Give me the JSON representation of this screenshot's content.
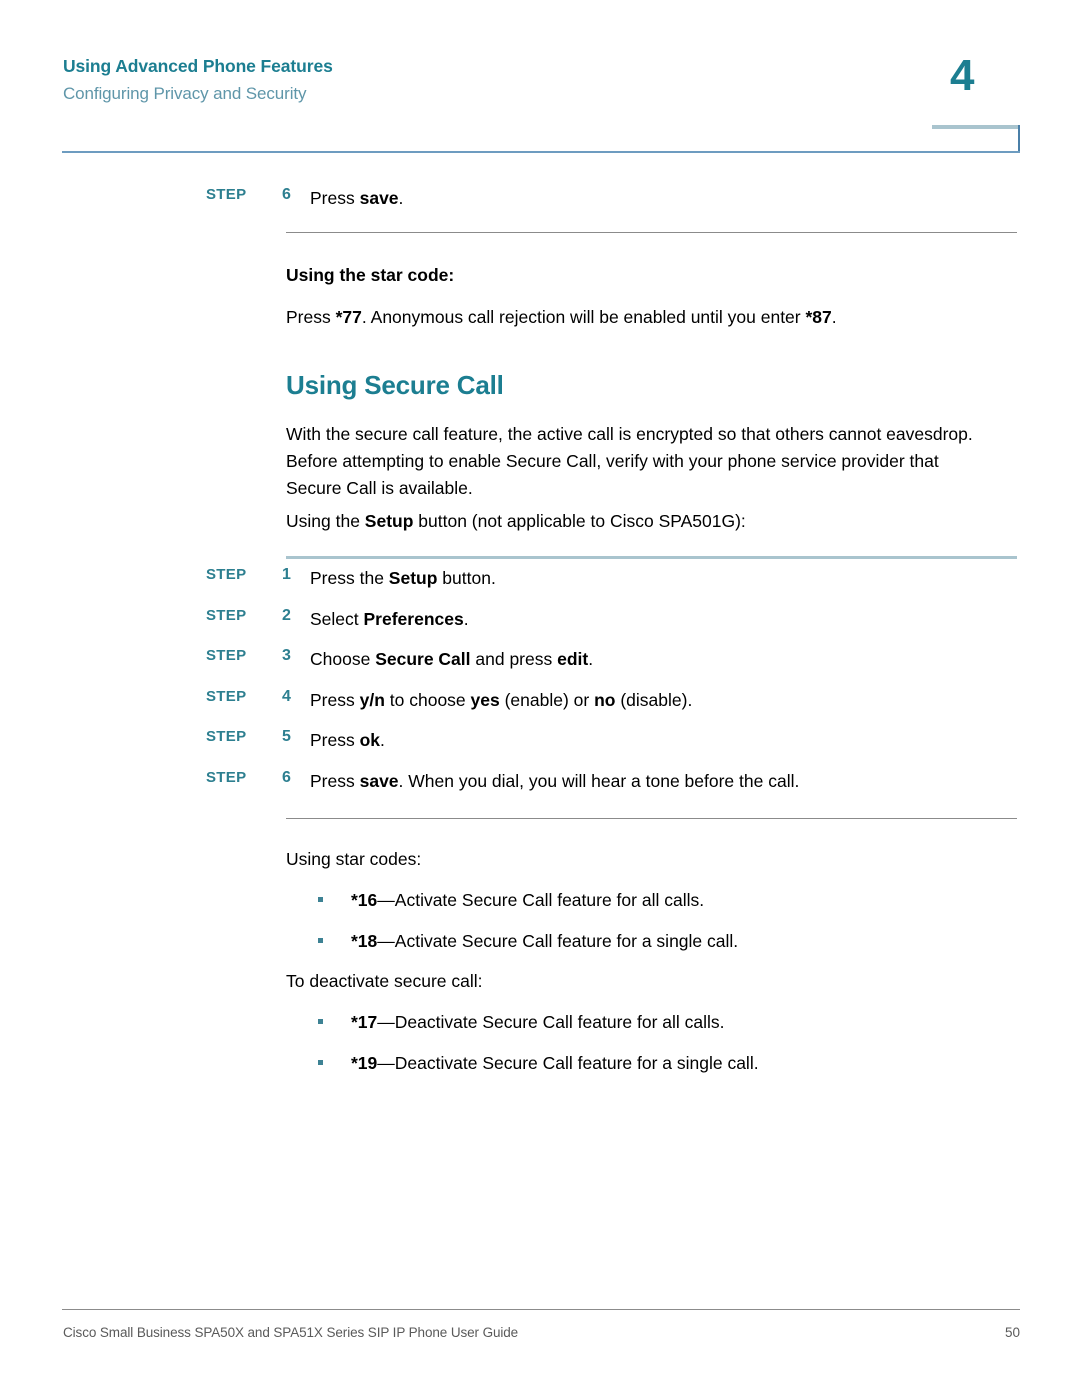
{
  "header": {
    "title": "Using Advanced Phone Features",
    "subtitle": "Configuring Privacy and Security",
    "chapter_number": "4",
    "accent_color": "#1c7e91",
    "subtitle_color": "#5f96a9"
  },
  "step_label": "STEP",
  "top_step": {
    "number": "6",
    "text_before": "Press ",
    "text_bold": "save",
    "text_after": "."
  },
  "star_code_block": {
    "heading": "Using the star code:",
    "text_1": "Press ",
    "code_1": "*77",
    "text_2": ". Anonymous call rejection will be enabled until you enter ",
    "code_2": "*87",
    "text_3": "."
  },
  "section": {
    "heading": "Using Secure Call",
    "paragraph": "With the secure call feature, the active call is encrypted so that others cannot eavesdrop. Before attempting to enable Secure Call, verify with your phone service provider that Secure Call is available.",
    "intro_before": "Using the ",
    "intro_bold": "Setup",
    "intro_after": " button (not applicable to Cisco SPA501G):"
  },
  "steps": [
    {
      "number": "1",
      "parts": [
        {
          "t": "Press the ",
          "b": false
        },
        {
          "t": "Setup",
          "b": true
        },
        {
          "t": " button.",
          "b": false
        }
      ]
    },
    {
      "number": "2",
      "parts": [
        {
          "t": "Select ",
          "b": false
        },
        {
          "t": "Preferences",
          "b": true
        },
        {
          "t": ".",
          "b": false
        }
      ]
    },
    {
      "number": "3",
      "parts": [
        {
          "t": "Choose ",
          "b": false
        },
        {
          "t": "Secure Call",
          "b": true
        },
        {
          "t": " and press ",
          "b": false
        },
        {
          "t": "edit",
          "b": true
        },
        {
          "t": ".",
          "b": false
        }
      ]
    },
    {
      "number": "4",
      "parts": [
        {
          "t": "Press ",
          "b": false
        },
        {
          "t": "y/n",
          "b": true
        },
        {
          "t": " to choose ",
          "b": false
        },
        {
          "t": "yes",
          "b": true
        },
        {
          "t": " (enable) or ",
          "b": false
        },
        {
          "t": "no",
          "b": true
        },
        {
          "t": " (disable).",
          "b": false
        }
      ]
    },
    {
      "number": "5",
      "parts": [
        {
          "t": "Press ",
          "b": false
        },
        {
          "t": "ok",
          "b": true
        },
        {
          "t": ".",
          "b": false
        }
      ]
    },
    {
      "number": "6",
      "parts": [
        {
          "t": "Press ",
          "b": false
        },
        {
          "t": "save",
          "b": true
        },
        {
          "t": ". When you dial, you will hear a tone before the call.",
          "b": false
        }
      ]
    }
  ],
  "star_codes": {
    "activate_intro": "Using star codes:",
    "activate_items": [
      {
        "code": "*16",
        "desc": "—Activate Secure Call feature for all calls."
      },
      {
        "code": "*18",
        "desc": "—Activate Secure Call feature for a single call."
      }
    ],
    "deactivate_intro": "To deactivate secure call:",
    "deactivate_items": [
      {
        "code": "*17",
        "desc": "—Deactivate Secure Call feature for all calls."
      },
      {
        "code": "*19",
        "desc": "—Deactivate Secure Call feature for a single call."
      }
    ]
  },
  "footer": {
    "text": "Cisco Small Business SPA50X and SPA51X Series SIP IP Phone User Guide",
    "page_number": "50"
  }
}
